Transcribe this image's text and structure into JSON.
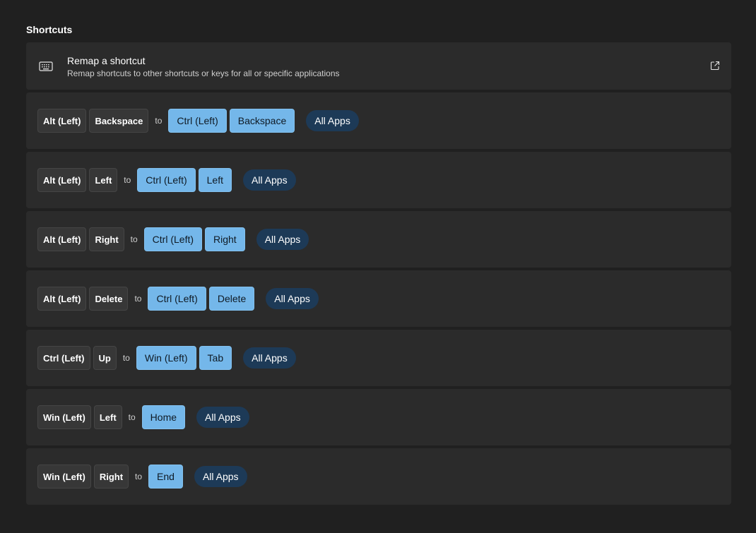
{
  "section": {
    "title": "Shortcuts"
  },
  "header": {
    "title": "Remap a shortcut",
    "description": "Remap shortcuts to other shortcuts or keys for all or specific applications",
    "icon": "keyboard-icon",
    "action_icon": "open-external-icon"
  },
  "connector": "to",
  "colors": {
    "background": "#202020",
    "card": "#2b2b2b",
    "source_key": "#373737",
    "target_key": "#74b7ea",
    "apps_pill": "#1d3a57"
  },
  "shortcuts": [
    {
      "from": [
        "Alt (Left)",
        "Backspace"
      ],
      "to": [
        "Ctrl (Left)",
        "Backspace"
      ],
      "apps": "All Apps"
    },
    {
      "from": [
        "Alt (Left)",
        "Left"
      ],
      "to": [
        "Ctrl (Left)",
        "Left"
      ],
      "apps": "All Apps"
    },
    {
      "from": [
        "Alt (Left)",
        "Right"
      ],
      "to": [
        "Ctrl (Left)",
        "Right"
      ],
      "apps": "All Apps"
    },
    {
      "from": [
        "Alt (Left)",
        "Delete"
      ],
      "to": [
        "Ctrl (Left)",
        "Delete"
      ],
      "apps": "All Apps"
    },
    {
      "from": [
        "Ctrl (Left)",
        "Up"
      ],
      "to": [
        "Win (Left)",
        "Tab"
      ],
      "apps": "All Apps"
    },
    {
      "from": [
        "Win (Left)",
        "Left"
      ],
      "to": [
        "Home"
      ],
      "apps": "All Apps"
    },
    {
      "from": [
        "Win (Left)",
        "Right"
      ],
      "to": [
        "End"
      ],
      "apps": "All Apps"
    }
  ]
}
